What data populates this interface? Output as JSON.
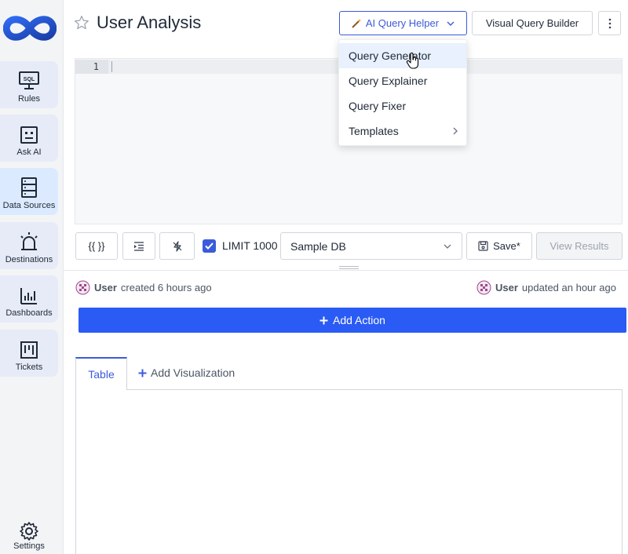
{
  "header": {
    "title": "User Analysis",
    "ai_helper_label": "AI Query Helper",
    "visual_builder_label": "Visual Query Builder"
  },
  "sidebar": {
    "items": [
      {
        "label": "Rules",
        "icon": "sql-monitor-icon"
      },
      {
        "label": "Ask AI",
        "icon": "robot-face-icon"
      },
      {
        "label": "Data Sources",
        "icon": "server-stack-icon"
      },
      {
        "label": "Destinations",
        "icon": "alarm-light-icon"
      },
      {
        "label": "Dashboards",
        "icon": "bar-chart-icon"
      },
      {
        "label": "Tickets",
        "icon": "kanban-icon"
      }
    ],
    "settings_label": "Settings",
    "sql_badge": "SQL"
  },
  "editor": {
    "line_number": "1"
  },
  "toolbar": {
    "template_label": "{{ }}",
    "limit_checked": true,
    "limit_label": "LIMIT 1000",
    "datasource_value": "Sample DB",
    "save_label": "Save*",
    "view_results_label": "View Results"
  },
  "meta": {
    "created_user": "User",
    "created_text": "created 6 hours ago",
    "updated_user": "User",
    "updated_text": "updated an hour ago"
  },
  "add_action_label": "Add Action",
  "tabs": {
    "table_label": "Table",
    "add_visualization_label": "Add Visualization"
  },
  "ai_menu": {
    "items": [
      {
        "label": "Query Generator",
        "active": true
      },
      {
        "label": "Query Explainer"
      },
      {
        "label": "Query Fixer"
      },
      {
        "label": "Templates",
        "has_submenu": true
      }
    ]
  },
  "colors": {
    "accent": "#3b5bdb",
    "add_action_bg": "#2a5bf5",
    "sidebar_bg": "#f3f4f6"
  }
}
